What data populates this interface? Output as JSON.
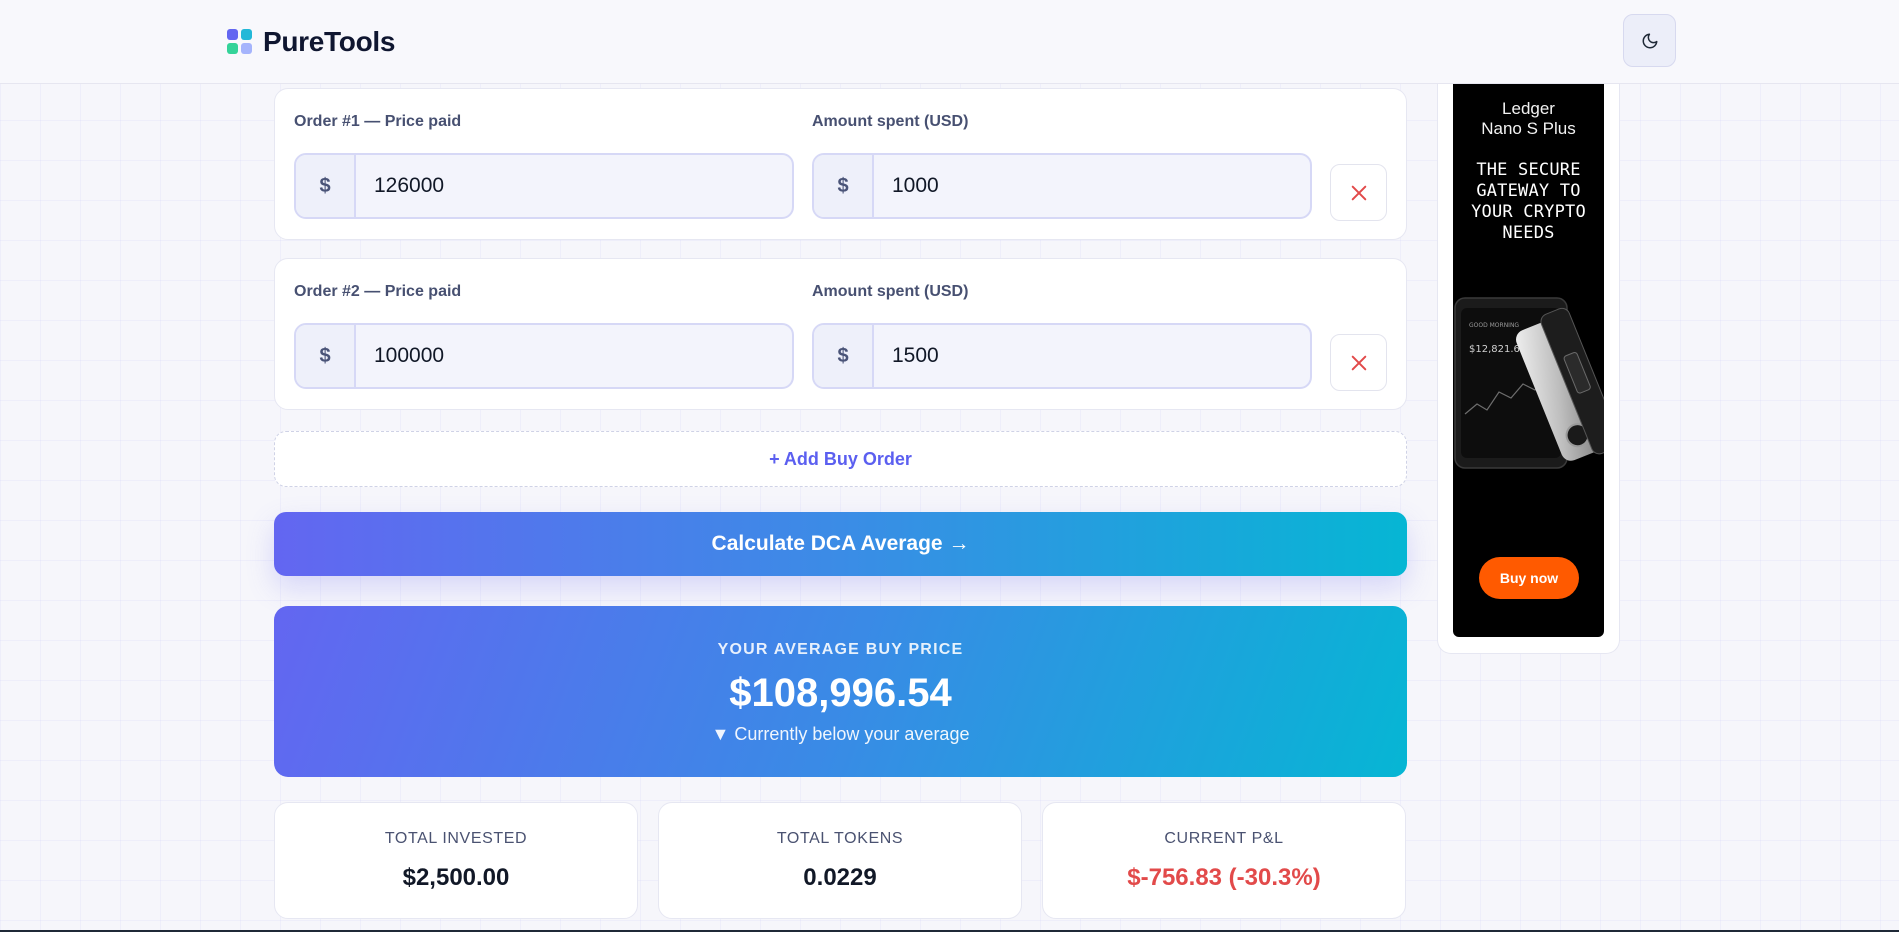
{
  "header": {
    "brand": "PureTools",
    "theme_toggle_icon": "moon-icon"
  },
  "orders": [
    {
      "price_label": "Order #1 — Price paid",
      "amount_label": "Amount spent (USD)",
      "currency_symbol": "$",
      "price_value": "126000",
      "amount_value": "1000"
    },
    {
      "price_label": "Order #2 — Price paid",
      "amount_label": "Amount spent (USD)",
      "currency_symbol": "$",
      "price_value": "100000",
      "amount_value": "1500"
    }
  ],
  "actions": {
    "add_order_label": "+ Add Buy Order",
    "calculate_label": "Calculate DCA Average →"
  },
  "result": {
    "label": "YOUR AVERAGE BUY PRICE",
    "value": "$108,996.54",
    "status": "▼ Currently below your average"
  },
  "stats": [
    {
      "label": "TOTAL INVESTED",
      "value": "$2,500.00"
    },
    {
      "label": "TOTAL TOKENS",
      "value": "0.0229"
    },
    {
      "label": "CURRENT P&L",
      "value": "$-756.83 (-30.3%)"
    }
  ],
  "ad": {
    "brand_line1": "Ledger",
    "brand_line2": "Nano S Plus",
    "headline_lines": [
      "THE SECURE",
      "GATEWAY TO",
      "YOUR CRYPTO",
      "NEEDS"
    ],
    "screen_amount": "$12,821.61",
    "cta": "Buy now"
  },
  "colors": {
    "accent": "#6366f1",
    "accent_end": "#06b6d4",
    "danger": "#e24a4a",
    "ad_cta": "#ff5a00"
  }
}
